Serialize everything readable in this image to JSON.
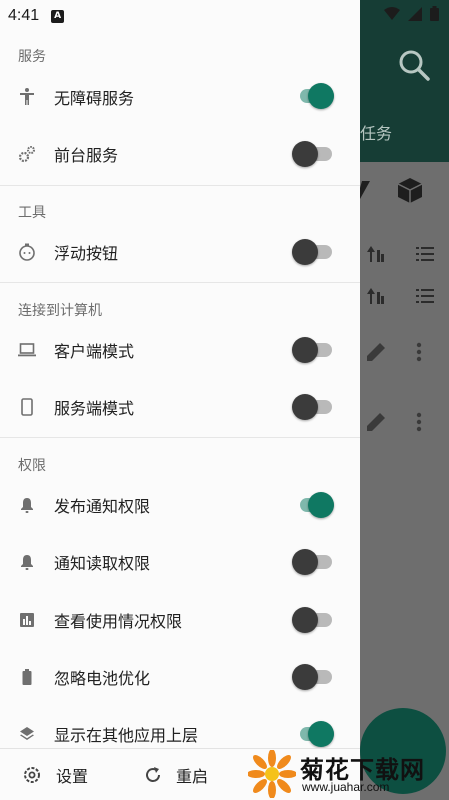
{
  "status_bar": {
    "time": "4:41"
  },
  "background": {
    "tab_label": "任务",
    "fab_label": "+"
  },
  "drawer": {
    "sections": [
      {
        "title": "服务",
        "items": [
          {
            "label": "无障碍服务",
            "icon": "accessibility-icon",
            "enabled": true
          },
          {
            "label": "前台服务",
            "icon": "gears-icon",
            "enabled": false
          }
        ]
      },
      {
        "title": "工具",
        "items": [
          {
            "label": "浮动按钮",
            "icon": "floating-button-icon",
            "enabled": false
          }
        ]
      },
      {
        "title": "连接到计算机",
        "items": [
          {
            "label": "客户端模式",
            "icon": "laptop-icon",
            "enabled": false
          },
          {
            "label": "服务端模式",
            "icon": "phone-icon",
            "enabled": false
          }
        ]
      },
      {
        "title": "权限",
        "items": [
          {
            "label": "发布通知权限",
            "icon": "bell-icon",
            "enabled": true
          },
          {
            "label": "通知读取权限",
            "icon": "bell-icon",
            "enabled": false
          },
          {
            "label": "查看使用情况权限",
            "icon": "bar-chart-icon",
            "enabled": false
          },
          {
            "label": "忽略电池优化",
            "icon": "battery-icon",
            "enabled": false
          },
          {
            "label": "显示在其他应用上层",
            "icon": "layers-icon",
            "enabled": true
          }
        ]
      }
    ],
    "bottom": {
      "settings_label": "设置",
      "restart_label": "重启"
    }
  },
  "watermark": {
    "text": "菊花下载网",
    "url": "www.juahar.com"
  },
  "colors": {
    "accent": "#0f7862",
    "header": "#163d35"
  }
}
